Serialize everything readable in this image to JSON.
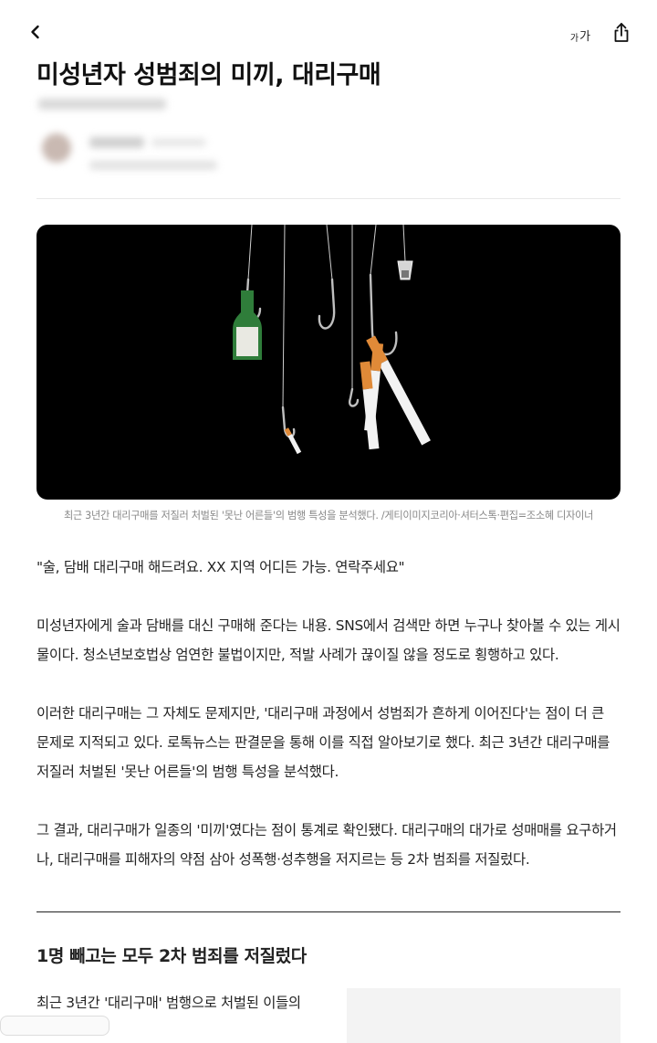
{
  "toolbar": {
    "back_icon": "chevron-left-icon",
    "font_size_label_small": "가",
    "font_size_label_large": "가",
    "share_icon": "share-icon"
  },
  "article": {
    "title": "미성년자 성범죄의 미끼, 대리구매",
    "photo_caption": "최근 3년간 대리구매를 저질러 처벌된 '못난 어른들'의 범행 특성을 분석했다. /게티이미지코리아·셔터스톡·편집=조소혜 디자이너",
    "paragraphs": [
      "\"술, 담배 대리구매 해드려요. XX 지역 어디든 가능. 연락주세요\"",
      "미성년자에게 술과 담배를 대신 구매해 준다는 내용. SNS에서 검색만 하면 누구나 찾아볼 수 있는 게시물이다. 청소년보호법상 엄연한 불법이지만, 적발 사례가 끊이질 않을 정도로 횡행하고 있다.",
      "이러한 대리구매는 그 자체도 문제지만, '대리구매 과정에서 성범죄가 흔하게 이어진다'는 점이 더 큰 문제로 지적되고 있다. 로톡뉴스는 판결문을 통해 이를 직접 알아보기로 했다. 최근 3년간 대리구매를 저질러 처벌된 '못난 어른들'의 범행 특성을 분석했다.",
      "그 결과, 대리구매가 일종의 '미끼'였다는 점이 통계로 확인됐다. 대리구매의 대가로 성매매를 요구하거나, 대리구매를 피해자의 약점 삼아 성폭행·성추행을 저지르는 등 2차 범죄를 저질렀다."
    ],
    "subheading": "1명 빼고는 모두 2차 범죄를 저질렀다",
    "section_paragraph": "최근 3년간 '대리구매' 범행으로 처벌된 이들의"
  },
  "colors": {
    "text": "#222222",
    "caption": "#888888",
    "photo_background": "#000000",
    "bottle": "#2f7d3a"
  }
}
